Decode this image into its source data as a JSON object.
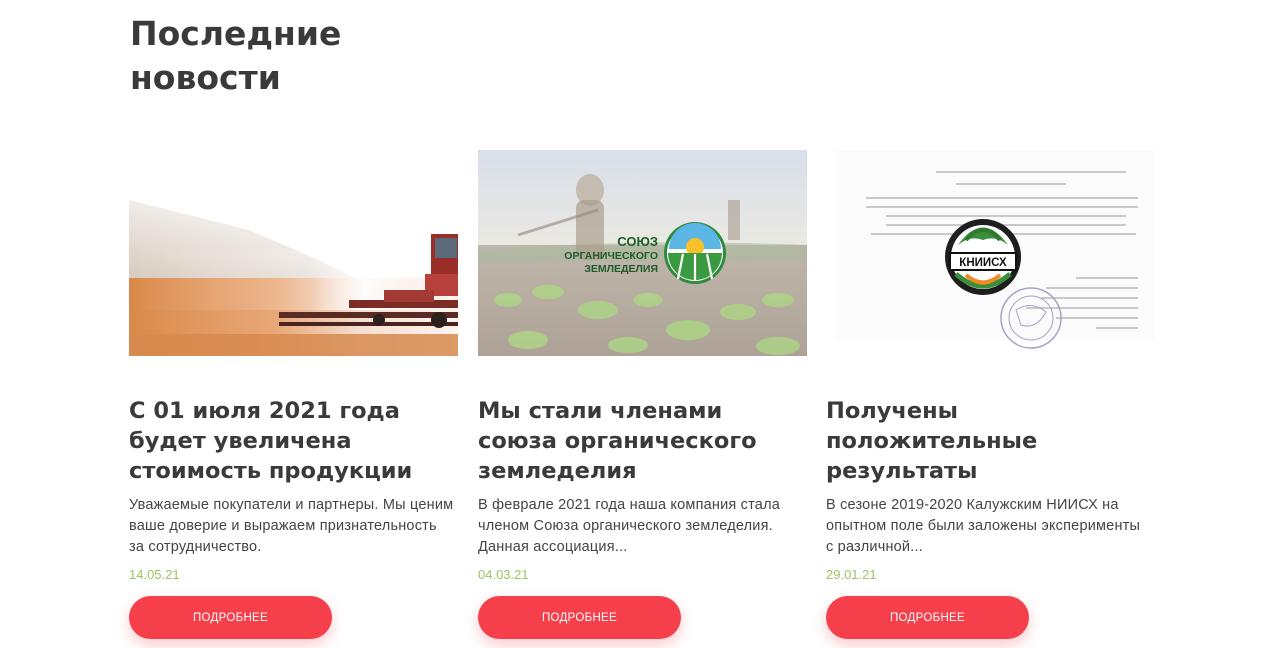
{
  "section": {
    "title": "Последние новости"
  },
  "colors": {
    "accent": "#f5404b",
    "date": "#9dc45f",
    "heading": "#3a3a3a"
  },
  "news": [
    {
      "title": "С 01 июля 2021 года будет увеличена стоимость продукции",
      "excerpt": "Уважаемые покупатели и партнеры. Мы ценим ваше доверие и выражаем признательность за сотрудничество.",
      "date": "14.05.21",
      "button": "ПОДРОБНЕЕ",
      "image": "combine-harvester-field-photo"
    },
    {
      "title": "Мы стали членами союза органического земледелия",
      "excerpt": "В феврале 2021 года наша компания стала членом Союза органического земледелия. Данная ассоциация...",
      "date": "04.03.21",
      "button": "ПОДРОБНЕЕ",
      "image": "organic-farming-union-photo",
      "image_logo": {
        "line1": "СОЮЗ",
        "line2": "ОРГАНИЧЕСКОГО",
        "line3": "ЗЕМЛЕДЕЛИЯ"
      }
    },
    {
      "title": "Получены положительные результаты",
      "excerpt": "В сезоне 2019-2020 Калужским НИИСХ на опытном поле были заложены эксперименты с различной...",
      "date": "29.01.21",
      "button": "ПОДРОБНЕЕ",
      "image": "research-institute-document-photo",
      "image_logo": {
        "text": "КНИИСХ"
      }
    }
  ]
}
